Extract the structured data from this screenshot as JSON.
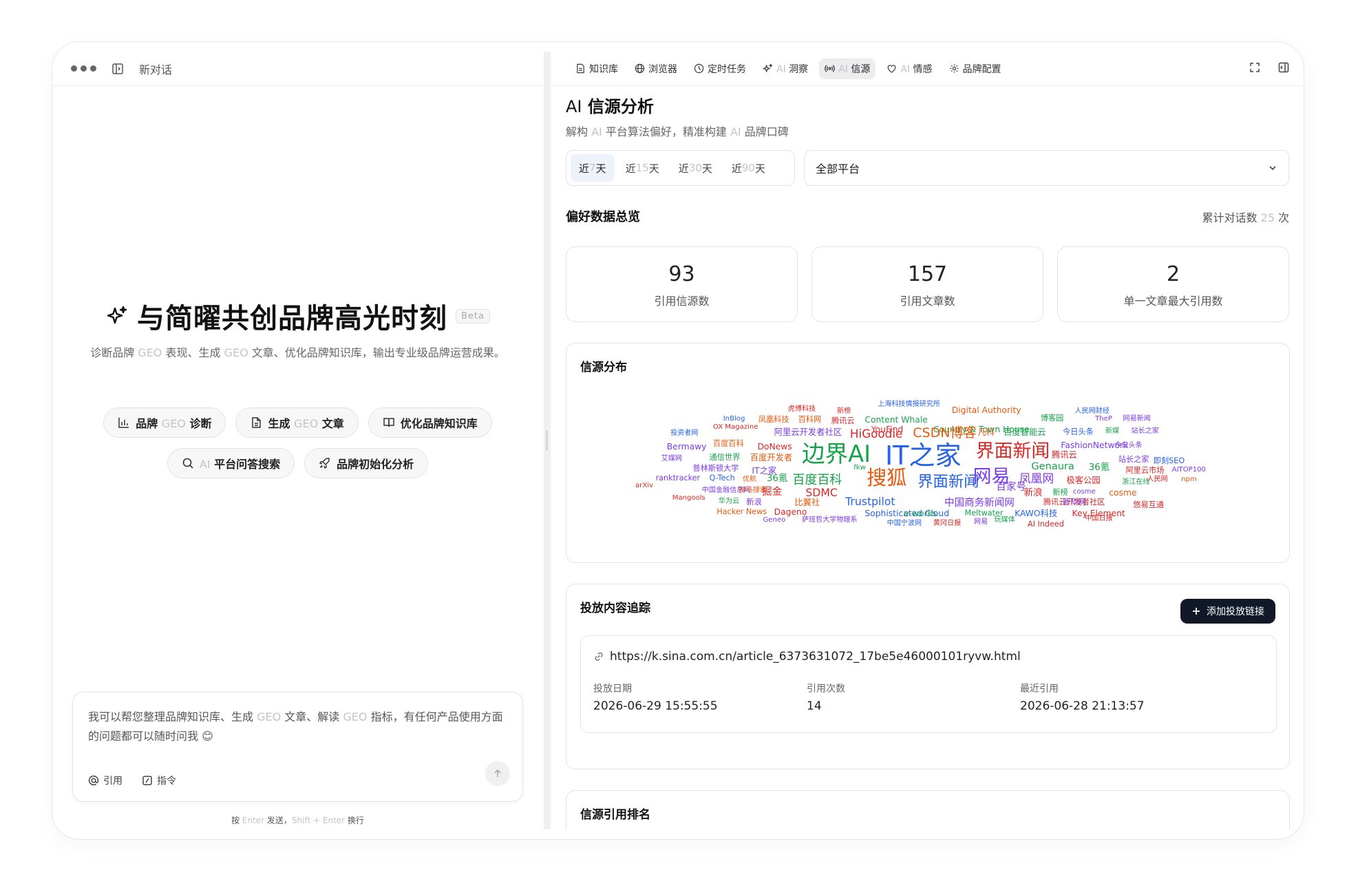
{
  "left": {
    "topbar": {
      "title": "新对话"
    },
    "hero": {
      "title": "与简曜共创品牌高光时刻",
      "badge": "Beta",
      "sub_pre": "诊断品牌 ",
      "sub_geo1": "GEO",
      "sub_mid": " 表现、生成 ",
      "sub_geo2": "GEO",
      "sub_post": " 文章、优化品牌知识库，输出专业级品牌运营成果。"
    },
    "chips": {
      "diagnose_a": "品牌 ",
      "diagnose_b": "GEO",
      "diagnose_c": " 诊断",
      "generate_a": "生成 ",
      "generate_b": "GEO",
      "generate_c": " 文章",
      "kb": "优化品牌知识库",
      "search_a": "AI",
      "search_b": " 平台问答搜索",
      "init": "品牌初始化分析"
    },
    "chat": {
      "t1": "我可以帮您整理品牌知识库、生成 ",
      "t2": "GEO",
      "t3": " 文章、解读 ",
      "t4": "GEO",
      "t5": " 指标，有任何产品使用方面的问题都可以随时问我 ",
      "emoji": "😊",
      "cite": "引用",
      "command": "指令"
    },
    "hint": {
      "a": "按 ",
      "b": "Enter",
      "c": " 发送，",
      "d": "Shift + Enter",
      "e": " 换行"
    }
  },
  "right": {
    "tabs": {
      "kb": "知识库",
      "browser": "浏览器",
      "tasks": "定时任务",
      "insight_ai": "AI",
      "insight": " 洞察",
      "source_ai": "AI",
      "source": " 信源",
      "sentiment_ai": "AI",
      "sentiment": " 情感",
      "brand": "品牌配置"
    },
    "title_ai": "AI",
    "title": " 信源分析",
    "subtitle": {
      "a": "解构 ",
      "b": "AI",
      "c": " 平台算法偏好，精准构建 ",
      "d": "AI",
      "e": " 品牌口碑"
    },
    "ranges": [
      {
        "a": "近 ",
        "n": "7",
        "b": " 天"
      },
      {
        "a": "近 ",
        "n": "15",
        "b": " 天"
      },
      {
        "a": "近 ",
        "n": "30",
        "b": " 天"
      },
      {
        "a": "近 ",
        "n": "90",
        "b": " 天"
      }
    ],
    "platform": "全部平台",
    "overview": "偏好数据总览",
    "total": {
      "a": "累计对话数 ",
      "n": "25",
      "b": " 次"
    },
    "stats": [
      {
        "num": "93",
        "label": "引用信源数"
      },
      {
        "num": "157",
        "label": "引用文章数"
      },
      {
        "num": "2",
        "label": "单一文章最大引用数"
      }
    ],
    "distribution": "信源分布",
    "cloud": [
      "上海科技情报研究所",
      "虎博科技",
      "新榜",
      "Digital Authority",
      "Content Whale",
      "InBlog",
      "凤凰科技",
      "百科网",
      "腾讯云",
      "博客园",
      "人民网财经",
      "OX Magazine",
      "YouFind",
      "Country & Town House",
      "TheP",
      "网易新闻",
      "投资者网",
      "阿里云开发者社区",
      "HiGoodie",
      "CSDN博客",
      "凡科",
      "百度智能云",
      "今日头条",
      "新媒",
      "站长之家",
      "Bermawy",
      "百度百科",
      "DoNews",
      "FashionNetwork",
      "今日头条",
      "边界AI",
      "IT之家",
      "界面新闻",
      "腾讯云",
      "站长之家",
      "即刻SEO",
      "艾媒网",
      "通信世界",
      "百度开发者",
      "Genaura",
      "36氪",
      "阿里云市场",
      "AITOP100",
      "普林斯顿大学",
      "IT之家",
      "fkw",
      "凤凰网",
      "极客公园",
      "人民网",
      "npm",
      "ranktracker",
      "Q-Tech",
      "优航",
      "36氪",
      "搜狐",
      "百度百科",
      "网易",
      "浙江在线",
      "arXiv",
      "中国金融信息网",
      "神马搜索",
      "掘金",
      "SDMC",
      "界面新闻",
      "百家号",
      "新浪",
      "新榜",
      "cosme",
      "cosme",
      "Mangools",
      "华为云",
      "新浪",
      "比翼社",
      "Trustpilot",
      "中国商务新闻网",
      "腾讯云开发者社区",
      "新华网",
      "悠易互通",
      "Hacker News",
      "Dageno",
      "Sophisticated Cloud",
      "e-works",
      "Meltwater",
      "KAWO科技",
      "Key Element",
      "中国日报",
      "Geneo",
      "萨班哲大学物理系",
      "中国宁波网",
      "黄冈日报",
      "网易",
      "玩媒体",
      "AI Indeed"
    ],
    "tracking": {
      "title": "投放内容追踪",
      "add": "添加投放链接",
      "url": "https://k.sina.com.cn/article_6373631072_17be5e46000101ryvw.html",
      "date_label": "投放日期",
      "date": "2026-06-29 15:55:55",
      "count_label": "引用次数",
      "count": "14",
      "last_label": "最近引用",
      "last": "2026-06-28 21:13:57"
    },
    "ranking": "信源引用排名"
  }
}
